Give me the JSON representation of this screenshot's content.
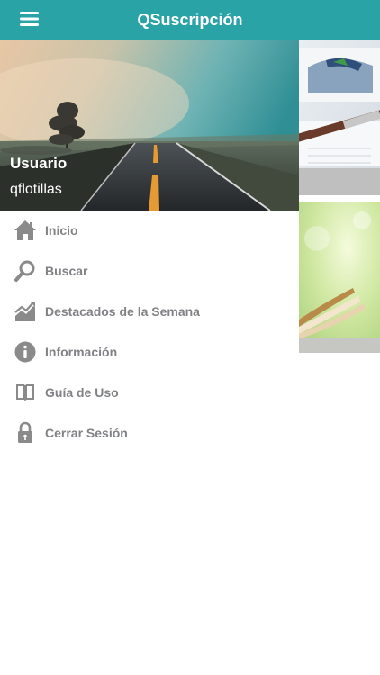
{
  "appbar": {
    "title": "QSuscripción",
    "menu_icon": "hamburger-menu-icon"
  },
  "drawer": {
    "user_name": "Usuario",
    "user_login": "qflotillas",
    "items": [
      {
        "label": "Inicio",
        "icon": "home-icon"
      },
      {
        "label": "Buscar",
        "icon": "search-icon"
      },
      {
        "label": "Destacados de la Semana",
        "icon": "trending-chart-icon"
      },
      {
        "label": "Información",
        "icon": "info-icon"
      },
      {
        "label": "Guía de Uso",
        "icon": "book-icon"
      },
      {
        "label": "Cerrar Sesión",
        "icon": "lock-icon"
      }
    ]
  },
  "colors": {
    "appbar": "#2aa3a7",
    "menu_text": "#808285",
    "icon": "#8a8a8a"
  }
}
